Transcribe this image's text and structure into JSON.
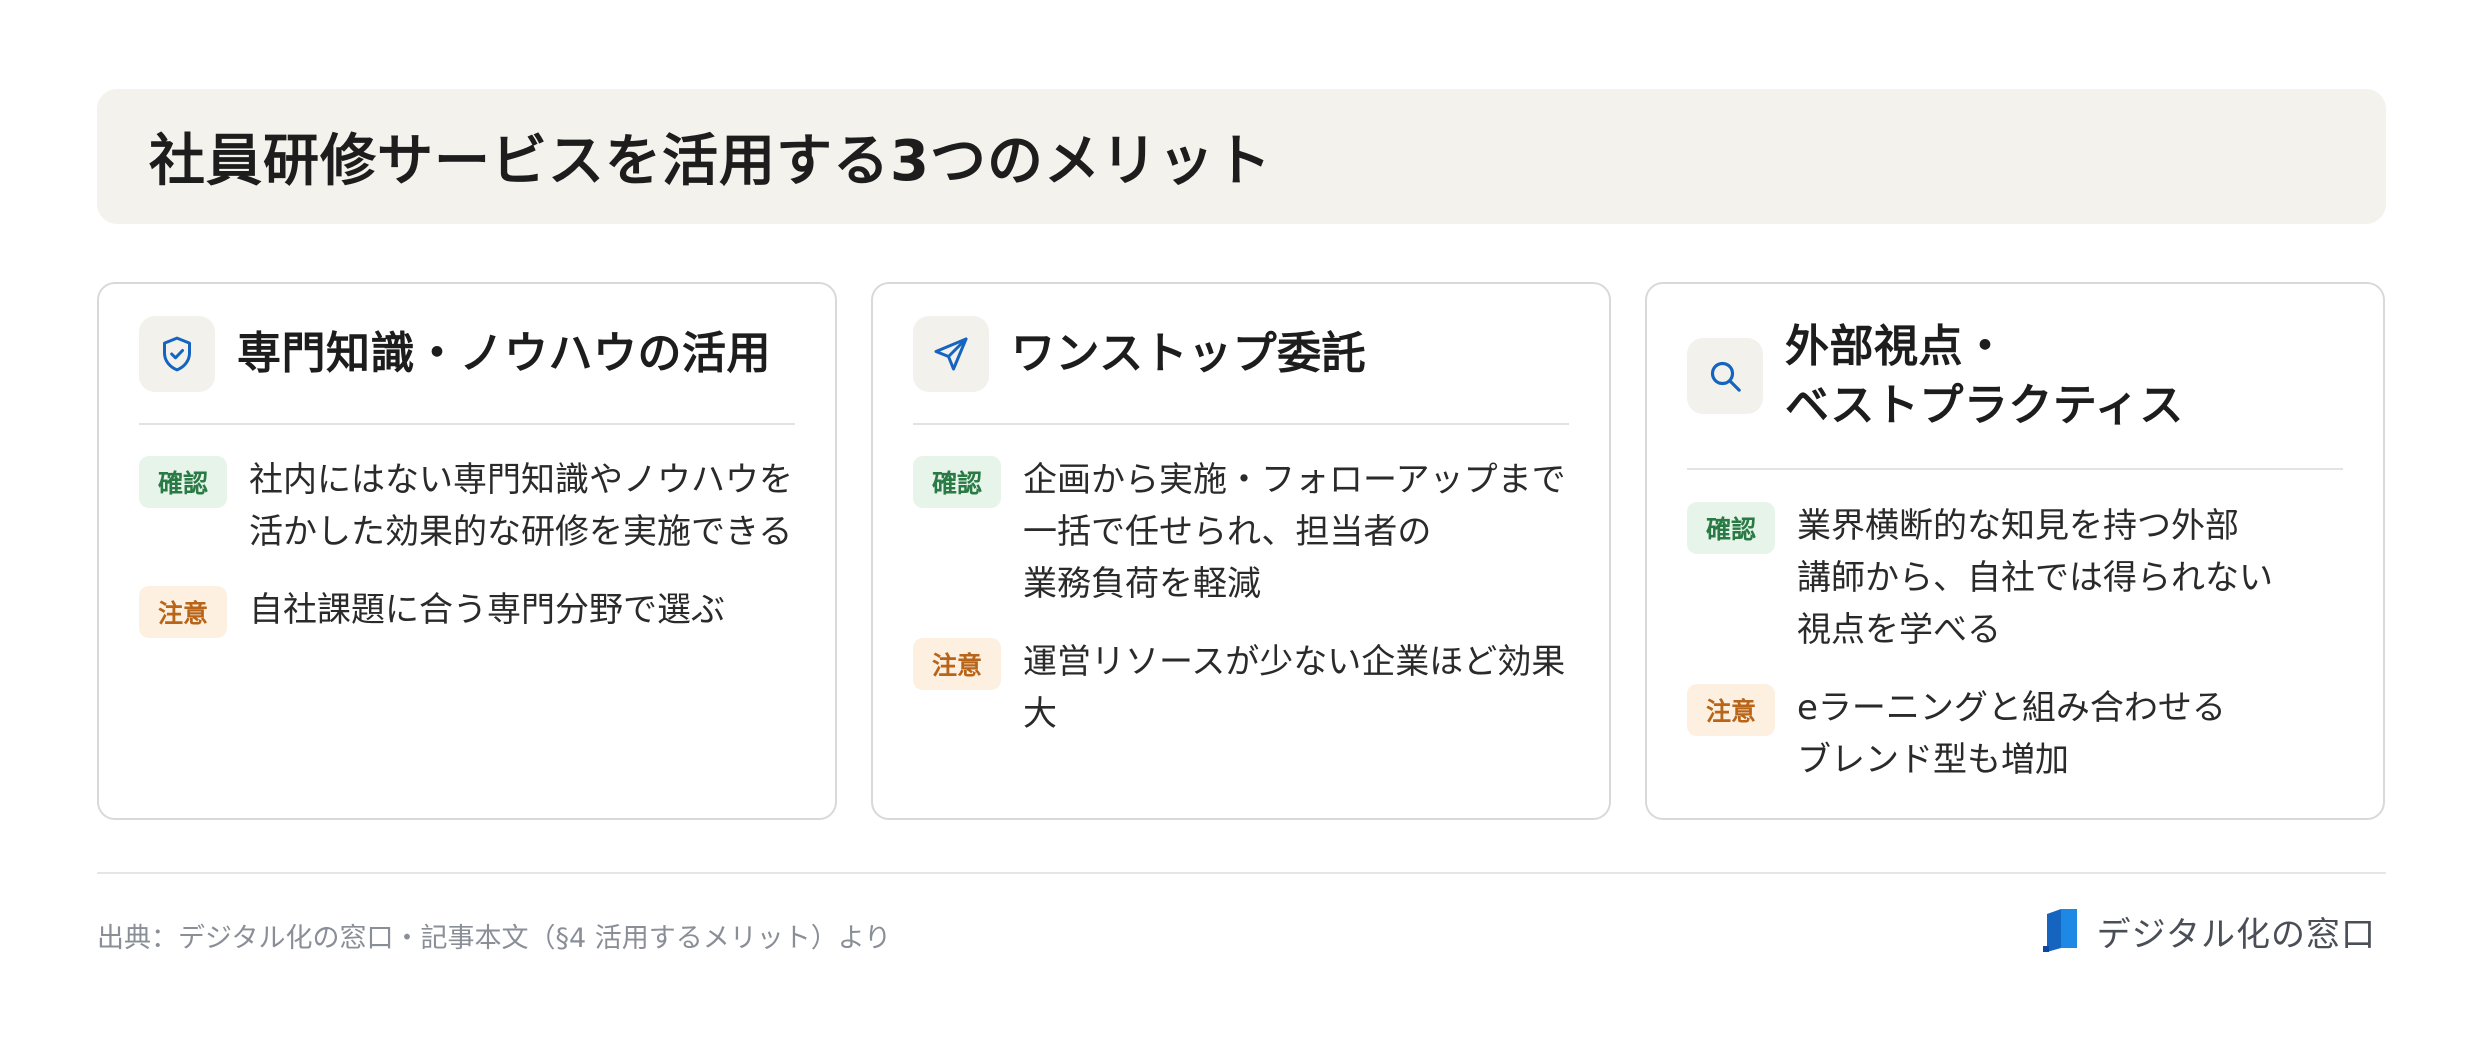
{
  "page_title": "社員研修サービスを活用する3つのメリット",
  "cards": [
    {
      "icon": "shield-check-icon",
      "title": "専門知識・ノウハウの活用",
      "items": [
        {
          "badge": "確認",
          "text": "社内にはない専門知識やノウハウを\n活かした効果的な研修を実施できる"
        },
        {
          "badge": "注意",
          "text": "自社課題に合う専門分野で選ぶ"
        }
      ]
    },
    {
      "icon": "send-icon",
      "title": "ワンストップ委託",
      "items": [
        {
          "badge": "確認",
          "text": "企画から実施・フォローアップまで\n一括で任せられ、担当者の\n業務負荷を軽減"
        },
        {
          "badge": "注意",
          "text": "運営リソースが少ない企業ほど効果\n大"
        }
      ]
    },
    {
      "icon": "search-icon",
      "title": "外部視点・\nベストプラクティス",
      "items": [
        {
          "badge": "確認",
          "text": "業界横断的な知見を持つ外部\n講師から、自社では得られない\n視点を学べる"
        },
        {
          "badge": "注意",
          "text": "eラーニングと組み合わせる\nブレンド型も増加"
        }
      ]
    }
  ],
  "footer": {
    "source": "出典：デジタル化の窓口・記事本文（§4 活用するメリット）より",
    "brand": "デジタル化の窓口",
    "brand_icon": "brand-logo-icon"
  },
  "colors": {
    "accent_blue": "#1565c0",
    "confirm_bg": "#e7f4ea",
    "confirm_text": "#2a7a45",
    "caution_bg": "#fdf0e0",
    "caution_text": "#b8651a",
    "title_bg": "#f4f2ec"
  }
}
